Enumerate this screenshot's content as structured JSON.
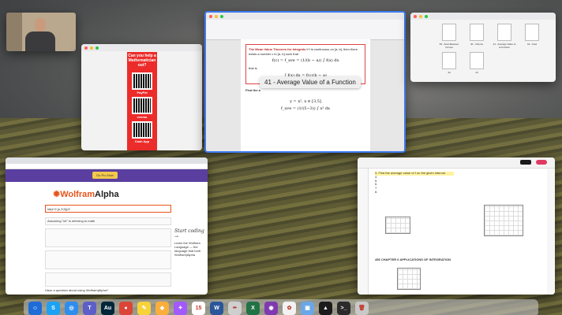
{
  "desktop": {
    "wallpaper": "vineyard-hills"
  },
  "webcam": {
    "subject": "presenter"
  },
  "donate": {
    "heading": "Can you help a Mathematician out?",
    "methods": [
      "PayPal",
      "venmo",
      "Cash App"
    ]
  },
  "document": {
    "theorem_title": "The Mean Value Theorem for Integrals",
    "theorem_text": "If f is continuous on [a, b], then there exists a number c in [a, b] such that",
    "eq1": "f(c) = f_ave = (1/(b − a)) ∫ f(x) dx",
    "that_is": "that is",
    "eq2": "∫ f(x) dx = f(c)(b − a)",
    "find_text": "Find the a",
    "func": "y = x²,    x ∈ [3,5]",
    "favg": "f_ave = (1/(5−3)) ∫ x² dx"
  },
  "caption": "41 - Average Value of a Function",
  "finder": {
    "files": [
      "39 - Area Between Curves",
      "40 - Volume",
      "41 - Average Value of a Function",
      "42 - Area",
      "43",
      "44"
    ]
  },
  "wolfram": {
    "upgrade": "Go Pro Now",
    "logo_a": "Wolfram",
    "logo_b": "Alpha",
    "query": "int(x^2,{x,3,5})/2",
    "interp": "Assuming \"int\" is referring to math",
    "side_script": "Start coding →",
    "side_text": "Learn the Wolfram Language — the language that built Wolfram|Alpha",
    "footer": "Have a question about using Wolfram|Alpha?"
  },
  "pdf": {
    "problems": [
      "3. Find the average value of f on the given interval.",
      "4.",
      "5.",
      "6.",
      "7.",
      "8."
    ],
    "chapter": "CHAPTER 6  APPLICATIONS OF INTEGRATION",
    "section_num": "456"
  },
  "dock": {
    "apps": [
      {
        "name": "finder",
        "glyph": "☺",
        "color": "#1e6cd8"
      },
      {
        "name": "skype",
        "glyph": "S",
        "color": "#1da1f2"
      },
      {
        "name": "safari",
        "glyph": "◎",
        "color": "#2e8ded"
      },
      {
        "name": "teams",
        "glyph": "T",
        "color": "#5b5fc7"
      },
      {
        "name": "audition",
        "glyph": "Au",
        "color": "#00263a"
      },
      {
        "name": "chrome",
        "glyph": "●",
        "color": "#db4437"
      },
      {
        "name": "notes",
        "glyph": "✎",
        "color": "#f7d23a"
      },
      {
        "name": "sketch",
        "glyph": "◆",
        "color": "#fbae3c"
      },
      {
        "name": "figma",
        "glyph": "✦",
        "color": "#a259ff"
      },
      {
        "name": "calendar",
        "glyph": "15",
        "color": "#ffffff"
      },
      {
        "name": "word",
        "glyph": "W",
        "color": "#2b579a"
      },
      {
        "name": "ink",
        "glyph": "✒",
        "color": "#cfcfcf"
      },
      {
        "name": "excel",
        "glyph": "X",
        "color": "#217346"
      },
      {
        "name": "podcast",
        "glyph": "◉",
        "color": "#7f3ab0"
      },
      {
        "name": "photos",
        "glyph": "✿",
        "color": "#f2f2f2"
      },
      {
        "name": "preview",
        "glyph": "▣",
        "color": "#6aa7e6"
      },
      {
        "name": "activity",
        "glyph": "▲",
        "color": "#1b1b1b"
      },
      {
        "name": "terminal",
        "glyph": ">_",
        "color": "#2b2b2b"
      },
      {
        "name": "trash",
        "glyph": "🗑",
        "color": "#c9c9c9"
      }
    ]
  }
}
